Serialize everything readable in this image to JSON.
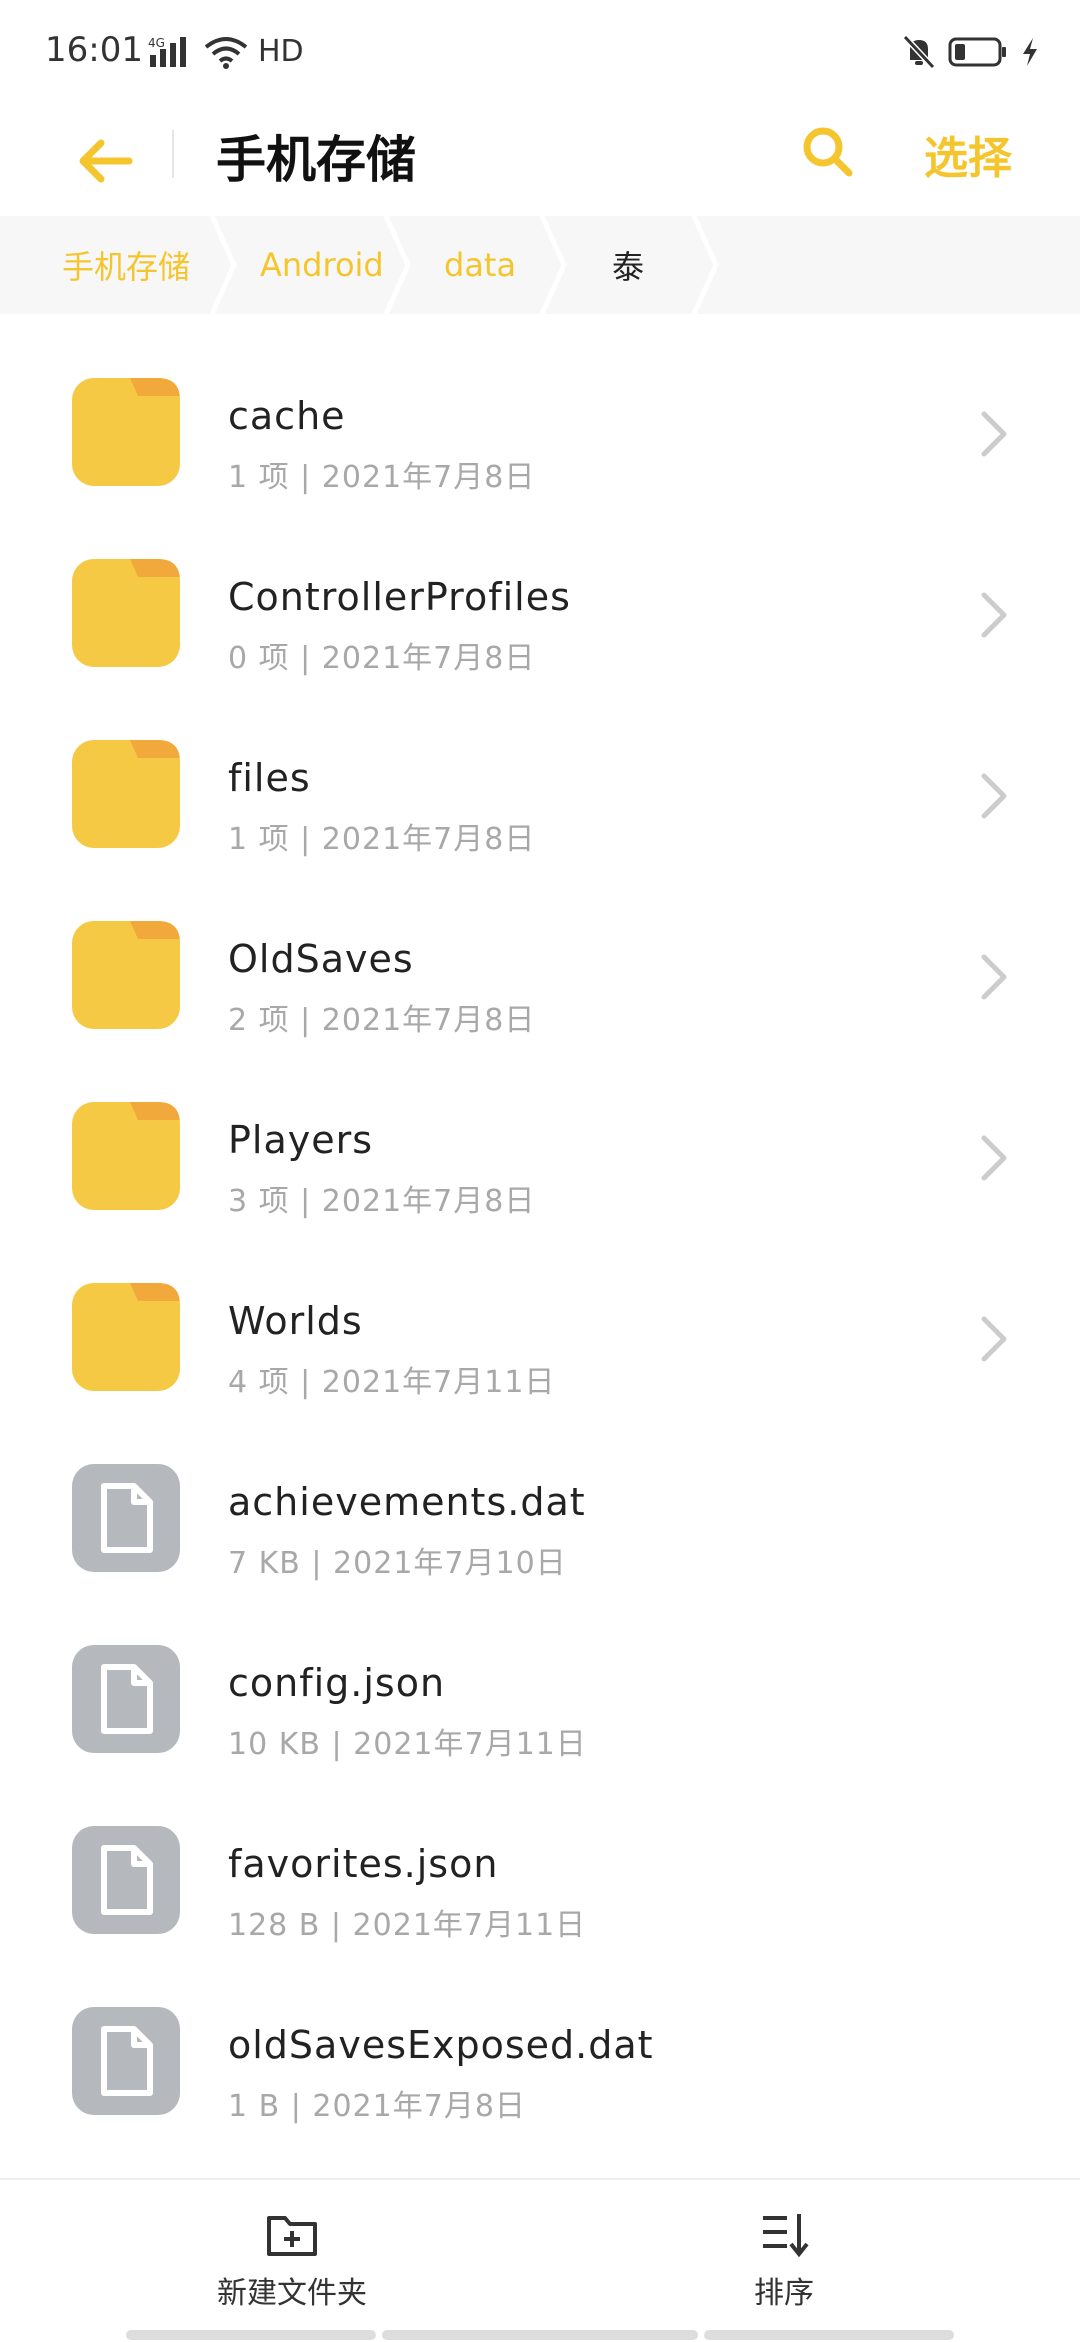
{
  "status_bar": {
    "time": "16:01",
    "network": "4G",
    "hd": "HD"
  },
  "header": {
    "title": "手机存储",
    "select_label": "选择"
  },
  "breadcrumb": {
    "items": [
      {
        "label": "手机存储"
      },
      {
        "label": "Android"
      },
      {
        "label": "data"
      },
      {
        "label": "泰"
      }
    ]
  },
  "files": [
    {
      "name": "cache",
      "meta": "1 项 | 2021年7月8日",
      "kind": "folder"
    },
    {
      "name": "ControllerProfiles",
      "meta": "0 项 | 2021年7月8日",
      "kind": "folder"
    },
    {
      "name": "files",
      "meta": "1 项 | 2021年7月8日",
      "kind": "folder"
    },
    {
      "name": "OldSaves",
      "meta": "2 项 | 2021年7月8日",
      "kind": "folder"
    },
    {
      "name": "Players",
      "meta": "3 项 | 2021年7月8日",
      "kind": "folder"
    },
    {
      "name": "Worlds",
      "meta": "4 项 | 2021年7月11日",
      "kind": "folder"
    },
    {
      "name": "achievements.dat",
      "meta": "7 KB | 2021年7月10日",
      "kind": "file"
    },
    {
      "name": "config.json",
      "meta": "10 KB | 2021年7月11日",
      "kind": "file"
    },
    {
      "name": "favorites.json",
      "meta": "128 B | 2021年7月11日",
      "kind": "file"
    },
    {
      "name": "oldSavesExposed.dat",
      "meta": "1 B | 2021年7月8日",
      "kind": "file"
    }
  ],
  "bottom_bar": {
    "new_folder_label": "新建文件夹",
    "sort_label": "排序"
  },
  "colors": {
    "accent": "#F5C52E",
    "folder": "#F6C945",
    "folder_tab": "#F2A93B",
    "file_icon": "#B5B9BE",
    "meta_text": "#A8A8A8"
  }
}
